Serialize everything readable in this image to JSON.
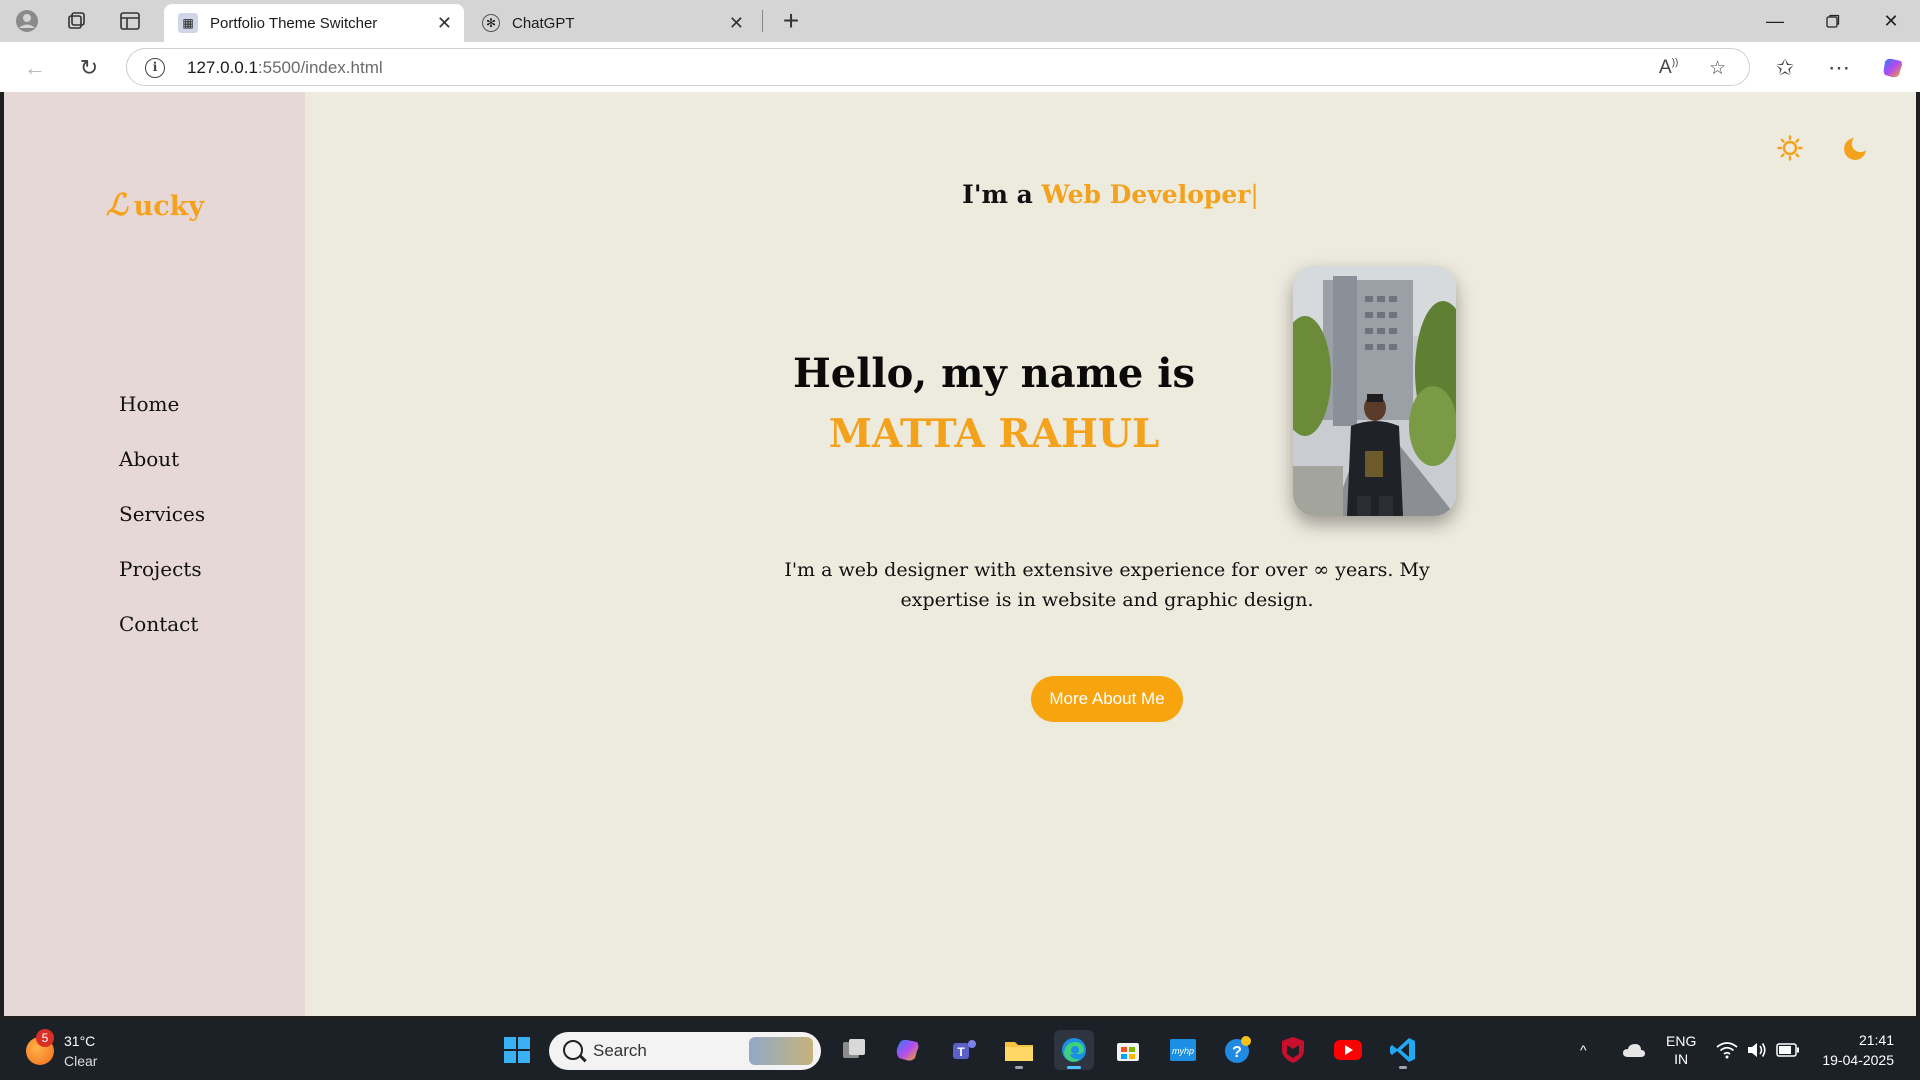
{
  "browser": {
    "tabs": [
      {
        "title": "Portfolio Theme Switcher",
        "active": true
      },
      {
        "title": "ChatGPT",
        "active": false
      }
    ],
    "url_host": "127.0.0.1",
    "url_rest": ":5500/index.html"
  },
  "page": {
    "logo_script": "ℒ",
    "logo_text": "ucky",
    "nav": [
      {
        "label": "Home"
      },
      {
        "label": "About"
      },
      {
        "label": "Services"
      },
      {
        "label": "Projects"
      },
      {
        "label": "Contact"
      }
    ],
    "theme_icons": {
      "light": "☼",
      "dark": "🌙"
    },
    "typing_prefix": "I'm a",
    "typing_role": "Web Developer",
    "typing_caret": "|",
    "hello_line": "Hello, my name is",
    "name": "MATTA RAHUL",
    "bio": "I'm a web designer with extensive experience for over ∞ years. My expertise is in website and graphic design.",
    "cta_label": "More About Me",
    "accent_color": "#f4a21c",
    "sidebar_color": "#e7d8d8",
    "background_color": "#edeade"
  },
  "taskbar": {
    "weather_badge": "5",
    "weather_temp": "31°C",
    "weather_cond": "Clear",
    "search_label": "Search",
    "lang_line1": "ENG",
    "lang_line2": "IN",
    "time": "21:41",
    "date": "19-04-2025"
  }
}
